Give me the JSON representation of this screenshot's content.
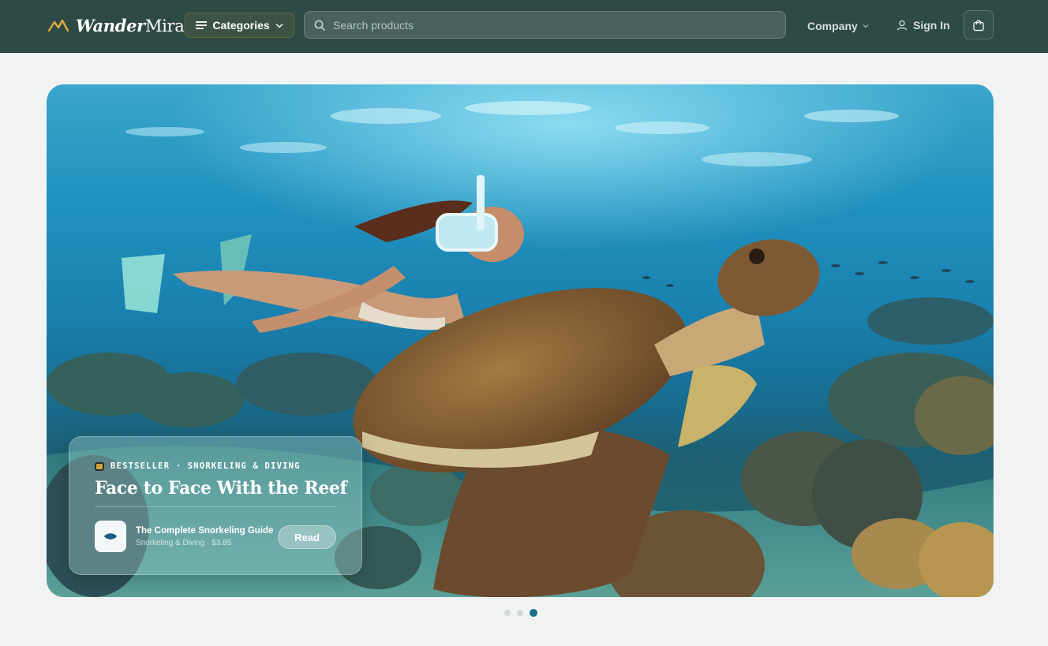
{
  "header": {
    "brand_bold": "Wander",
    "brand_regular": "Mira",
    "categories_label": "Categories",
    "search_placeholder": "Search products",
    "company_label": "Company",
    "signin_label": "Sign In",
    "cart_icon": "shopping-bag-icon"
  },
  "hero": {
    "image_subject": "snorkeler-and-sea-turtle-over-coral-reef",
    "tag": "BESTSELLER · SNORKELING & DIVING",
    "title": "Face to Face With the Reef",
    "book_title": "The Complete Snorkeling Guide",
    "book_meta": "Snorkeling & Diving · $3.85",
    "read_label": "Read"
  },
  "pagination": {
    "total": 3,
    "active": 3
  },
  "colors": {
    "header_bg": "#2e4a45",
    "page_bg": "#f1f3f2",
    "brand_accent": "#e0a93a",
    "active_dot": "#1a6f8f"
  }
}
